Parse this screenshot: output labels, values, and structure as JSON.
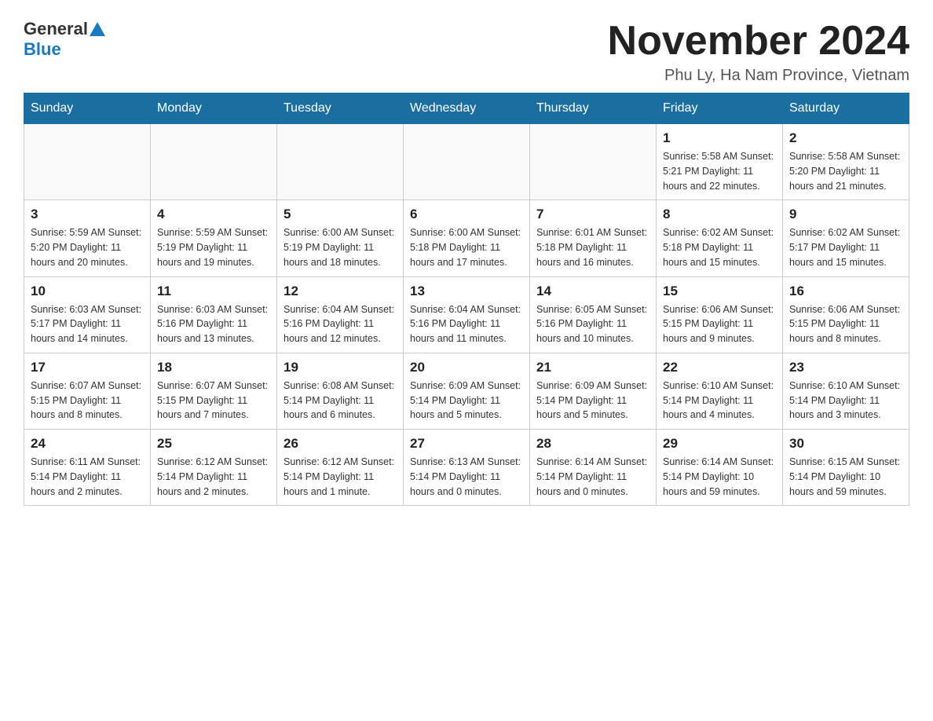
{
  "header": {
    "logo_general": "General",
    "logo_blue": "Blue",
    "month_title": "November 2024",
    "location": "Phu Ly, Ha Nam Province, Vietnam"
  },
  "weekdays": [
    "Sunday",
    "Monday",
    "Tuesday",
    "Wednesday",
    "Thursday",
    "Friday",
    "Saturday"
  ],
  "weeks": [
    [
      {
        "day": "",
        "info": ""
      },
      {
        "day": "",
        "info": ""
      },
      {
        "day": "",
        "info": ""
      },
      {
        "day": "",
        "info": ""
      },
      {
        "day": "",
        "info": ""
      },
      {
        "day": "1",
        "info": "Sunrise: 5:58 AM\nSunset: 5:21 PM\nDaylight: 11 hours and 22 minutes."
      },
      {
        "day": "2",
        "info": "Sunrise: 5:58 AM\nSunset: 5:20 PM\nDaylight: 11 hours and 21 minutes."
      }
    ],
    [
      {
        "day": "3",
        "info": "Sunrise: 5:59 AM\nSunset: 5:20 PM\nDaylight: 11 hours and 20 minutes."
      },
      {
        "day": "4",
        "info": "Sunrise: 5:59 AM\nSunset: 5:19 PM\nDaylight: 11 hours and 19 minutes."
      },
      {
        "day": "5",
        "info": "Sunrise: 6:00 AM\nSunset: 5:19 PM\nDaylight: 11 hours and 18 minutes."
      },
      {
        "day": "6",
        "info": "Sunrise: 6:00 AM\nSunset: 5:18 PM\nDaylight: 11 hours and 17 minutes."
      },
      {
        "day": "7",
        "info": "Sunrise: 6:01 AM\nSunset: 5:18 PM\nDaylight: 11 hours and 16 minutes."
      },
      {
        "day": "8",
        "info": "Sunrise: 6:02 AM\nSunset: 5:18 PM\nDaylight: 11 hours and 15 minutes."
      },
      {
        "day": "9",
        "info": "Sunrise: 6:02 AM\nSunset: 5:17 PM\nDaylight: 11 hours and 15 minutes."
      }
    ],
    [
      {
        "day": "10",
        "info": "Sunrise: 6:03 AM\nSunset: 5:17 PM\nDaylight: 11 hours and 14 minutes."
      },
      {
        "day": "11",
        "info": "Sunrise: 6:03 AM\nSunset: 5:16 PM\nDaylight: 11 hours and 13 minutes."
      },
      {
        "day": "12",
        "info": "Sunrise: 6:04 AM\nSunset: 5:16 PM\nDaylight: 11 hours and 12 minutes."
      },
      {
        "day": "13",
        "info": "Sunrise: 6:04 AM\nSunset: 5:16 PM\nDaylight: 11 hours and 11 minutes."
      },
      {
        "day": "14",
        "info": "Sunrise: 6:05 AM\nSunset: 5:16 PM\nDaylight: 11 hours and 10 minutes."
      },
      {
        "day": "15",
        "info": "Sunrise: 6:06 AM\nSunset: 5:15 PM\nDaylight: 11 hours and 9 minutes."
      },
      {
        "day": "16",
        "info": "Sunrise: 6:06 AM\nSunset: 5:15 PM\nDaylight: 11 hours and 8 minutes."
      }
    ],
    [
      {
        "day": "17",
        "info": "Sunrise: 6:07 AM\nSunset: 5:15 PM\nDaylight: 11 hours and 8 minutes."
      },
      {
        "day": "18",
        "info": "Sunrise: 6:07 AM\nSunset: 5:15 PM\nDaylight: 11 hours and 7 minutes."
      },
      {
        "day": "19",
        "info": "Sunrise: 6:08 AM\nSunset: 5:14 PM\nDaylight: 11 hours and 6 minutes."
      },
      {
        "day": "20",
        "info": "Sunrise: 6:09 AM\nSunset: 5:14 PM\nDaylight: 11 hours and 5 minutes."
      },
      {
        "day": "21",
        "info": "Sunrise: 6:09 AM\nSunset: 5:14 PM\nDaylight: 11 hours and 5 minutes."
      },
      {
        "day": "22",
        "info": "Sunrise: 6:10 AM\nSunset: 5:14 PM\nDaylight: 11 hours and 4 minutes."
      },
      {
        "day": "23",
        "info": "Sunrise: 6:10 AM\nSunset: 5:14 PM\nDaylight: 11 hours and 3 minutes."
      }
    ],
    [
      {
        "day": "24",
        "info": "Sunrise: 6:11 AM\nSunset: 5:14 PM\nDaylight: 11 hours and 2 minutes."
      },
      {
        "day": "25",
        "info": "Sunrise: 6:12 AM\nSunset: 5:14 PM\nDaylight: 11 hours and 2 minutes."
      },
      {
        "day": "26",
        "info": "Sunrise: 6:12 AM\nSunset: 5:14 PM\nDaylight: 11 hours and 1 minute."
      },
      {
        "day": "27",
        "info": "Sunrise: 6:13 AM\nSunset: 5:14 PM\nDaylight: 11 hours and 0 minutes."
      },
      {
        "day": "28",
        "info": "Sunrise: 6:14 AM\nSunset: 5:14 PM\nDaylight: 11 hours and 0 minutes."
      },
      {
        "day": "29",
        "info": "Sunrise: 6:14 AM\nSunset: 5:14 PM\nDaylight: 10 hours and 59 minutes."
      },
      {
        "day": "30",
        "info": "Sunrise: 6:15 AM\nSunset: 5:14 PM\nDaylight: 10 hours and 59 minutes."
      }
    ]
  ]
}
